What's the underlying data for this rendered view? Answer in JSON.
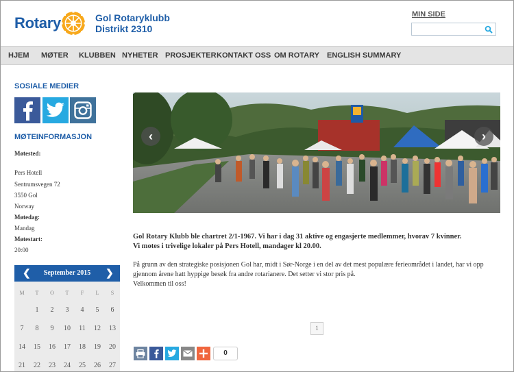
{
  "header": {
    "logo_word": "Rotary",
    "club_line1": "Gol Rotaryklubb",
    "club_line2": "Distrikt 2310",
    "min_side": "MIN SIDE",
    "search_value": ""
  },
  "nav": {
    "items": [
      "HJEM",
      "MØTER",
      "KLUBBEN",
      "NYHETER",
      "PROSJEKTER",
      "KONTAKT OSS",
      "OM ROTARY",
      "ENGLISH SUMMARY"
    ]
  },
  "sidebar": {
    "social_heading": "SOSIALE MEDIER",
    "social": [
      {
        "icon": "facebook-icon"
      },
      {
        "icon": "twitter-icon"
      },
      {
        "icon": "instagram-icon"
      }
    ],
    "meeting_heading": "MØTEINFORMASJON",
    "motested_label": "Møtested:",
    "venue": "Pers Hotell",
    "street": "Sentrumsvegen 72",
    "postal": "3550 Gol",
    "country": "Norway",
    "motedag_label": "Møtedag:",
    "motedag": "Mandag",
    "motestart_label": "Møtestart:",
    "motestart": "20:00"
  },
  "calendar": {
    "title": "September 2015",
    "prev": "❮",
    "next": "❯",
    "weekdays": [
      "M",
      "T",
      "O",
      "T",
      "F",
      "L",
      "S"
    ],
    "rows": [
      [
        "",
        "1",
        "2",
        "3",
        "4",
        "5",
        "6"
      ],
      [
        "7",
        "8",
        "9",
        "10",
        "11",
        "12",
        "13"
      ],
      [
        "14",
        "15",
        "16",
        "17",
        "18",
        "19",
        "20"
      ],
      [
        "21",
        "22",
        "23",
        "24",
        "25",
        "26",
        "27"
      ]
    ]
  },
  "slider": {
    "prev": "‹",
    "next": "›"
  },
  "content": {
    "lead_line1": "Gol Rotary Klubb ble chartret 2/1-1967. Vi har i dag 31 aktive og engasjerte medlemmer, hvorav 7 kvinner.",
    "lead_line2": "Vi motes i trivelige lokaler på Pers Hotell, mandager kl 20.00.",
    "para_line1": "På grunn av den strategiske posisjonen Gol har, midt i Sør-Norge i en del av det mest populære ferieområdet i landet, har vi opp",
    "para_line2": "gjennom årene hatt hyppige besøk fra andre rotarianere. Det setter vi stor pris på.",
    "para_line3": "Velkommen til oss!",
    "page": "1"
  },
  "share": {
    "count": "0",
    "colors": {
      "print": "#6d84a0",
      "facebook": "#3b5a9a",
      "twitter": "#27a9e1",
      "email": "#888888",
      "plus": "#f0663e"
    }
  },
  "colors": {
    "brand": "#1f5ea8",
    "nav_bg": "#e4e4e4",
    "wheel": "#f7a81b"
  }
}
